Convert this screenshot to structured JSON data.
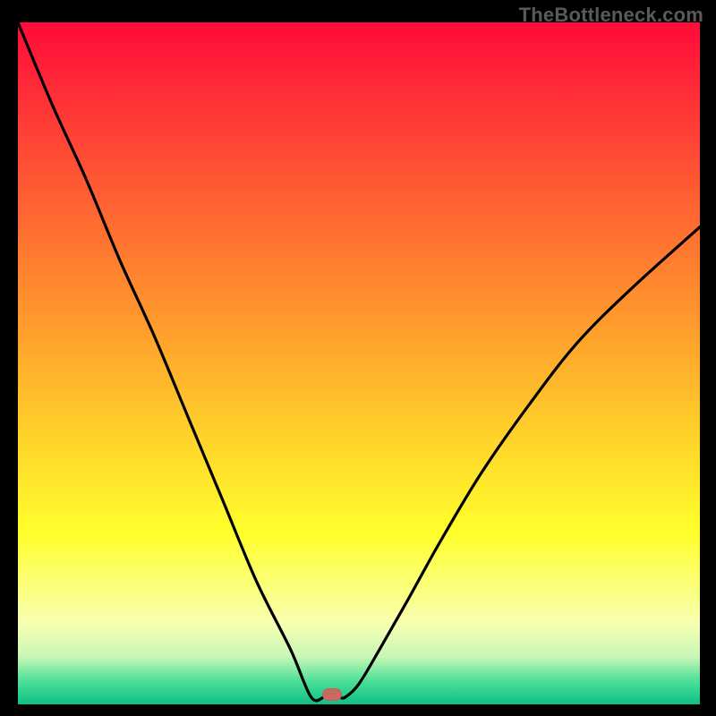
{
  "watermark": "TheBottleneck.com",
  "chart_data": {
    "type": "line",
    "title": "",
    "xlabel": "",
    "ylabel": "",
    "xlim": [
      0,
      100
    ],
    "ylim": [
      0,
      100
    ],
    "x": [
      0,
      5,
      10,
      15,
      20,
      25,
      30,
      35,
      40,
      43,
      45,
      47,
      48,
      50,
      53,
      57,
      62,
      68,
      75,
      82,
      90,
      100
    ],
    "values": [
      100,
      88,
      77,
      65,
      54,
      42,
      30,
      18,
      8,
      1,
      0,
      0,
      1,
      3,
      8,
      15,
      24,
      34,
      44,
      53,
      61,
      70
    ],
    "min_point": {
      "x": 46,
      "y": 0
    },
    "grid": false,
    "legend": false,
    "background_gradient": {
      "stops": [
        {
          "offset": 0.0,
          "color": "#ff0b3a"
        },
        {
          "offset": 0.2,
          "color": "#ff4d34"
        },
        {
          "offset": 0.4,
          "color": "#ff8d2e"
        },
        {
          "offset": 0.6,
          "color": "#ffd02a"
        },
        {
          "offset": 0.75,
          "color": "#ffff2c"
        },
        {
          "offset": 0.88,
          "color": "#f8ffb0"
        },
        {
          "offset": 0.93,
          "color": "#c8f7b6"
        },
        {
          "offset": 0.965,
          "color": "#4fe09a"
        },
        {
          "offset": 1.0,
          "color": "#0cc184"
        }
      ]
    },
    "marker": {
      "color": "#c76a62",
      "shape": "pill"
    }
  }
}
